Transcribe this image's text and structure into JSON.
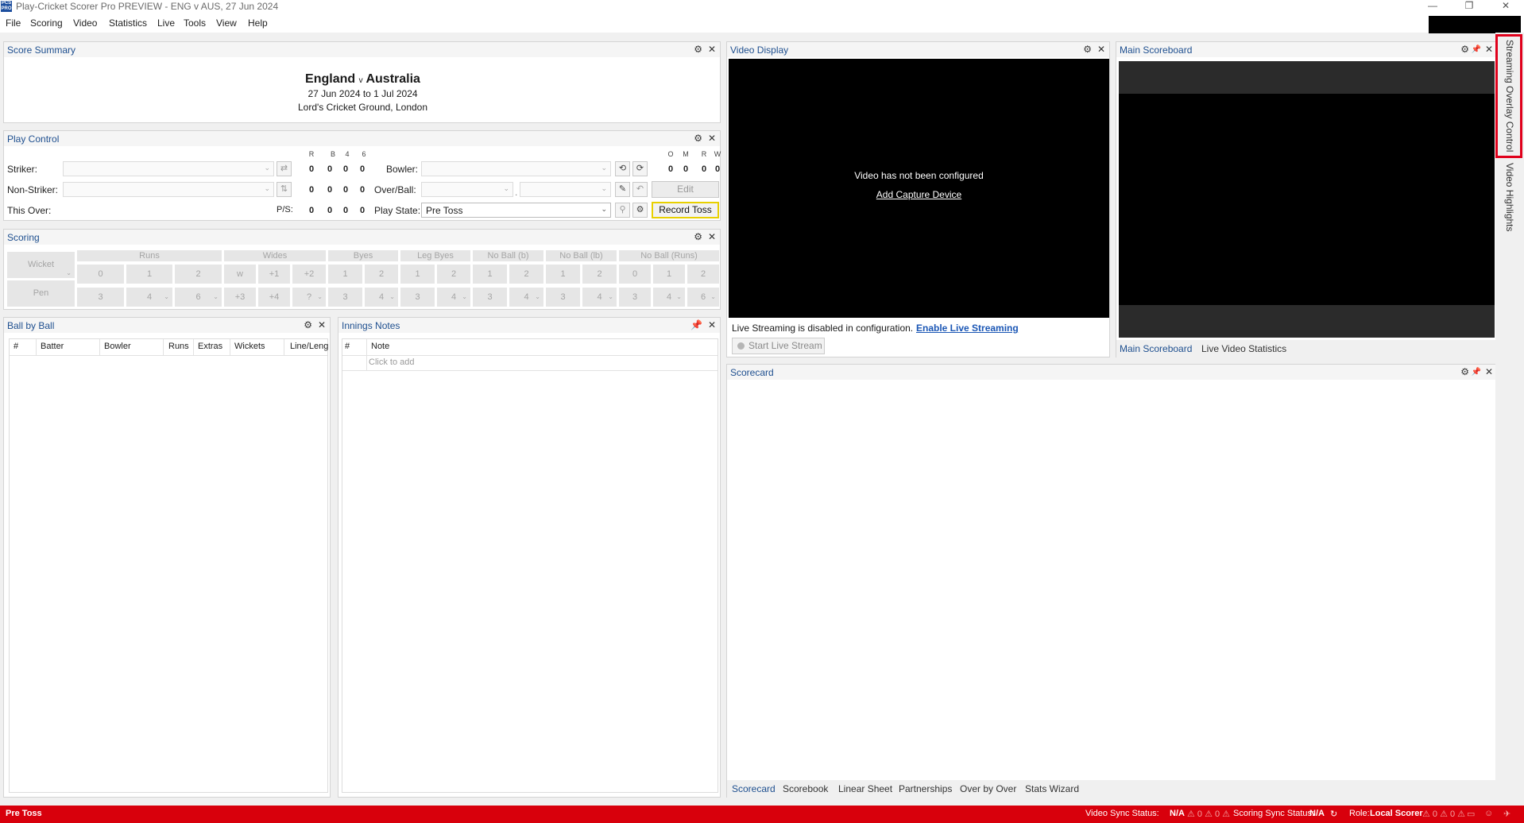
{
  "app": {
    "title": "Play-Cricket Scorer Pro PREVIEW - ENG v AUS, 27 Jun 2024",
    "logo": "PCS PRO"
  },
  "window_controls": {
    "minimize": "—",
    "restore": "❐",
    "close": "✕"
  },
  "menu": [
    "File",
    "Scoring",
    "Video",
    "Statistics",
    "Live",
    "Tools",
    "View",
    "Help"
  ],
  "score_summary": {
    "title": "Score Summary",
    "team1": "England",
    "vs": "v",
    "team2": "Australia",
    "dates": "27 Jun 2024 to 1 Jul 2024",
    "venue": "Lord's Cricket Ground, London"
  },
  "play_control": {
    "title": "Play Control",
    "bat_headers": [
      "R",
      "B",
      "4",
      "6"
    ],
    "bowl_headers": [
      "O",
      "M",
      "R",
      "W"
    ],
    "striker_label": "Striker:",
    "nonstriker_label": "Non-Striker:",
    "thisover_label": "This Over:",
    "ps_label": "P/S:",
    "striker_stats": [
      "0",
      "0",
      "0",
      "0"
    ],
    "nonstriker_stats": [
      "0",
      "0",
      "0",
      "0"
    ],
    "ps_stats": [
      "0",
      "0",
      "0",
      "0"
    ],
    "bowler_label": "Bowler:",
    "overball_label": "Over/Ball:",
    "playstate_label": "Play State:",
    "bowler_stats": [
      "0",
      "0",
      "0",
      "0"
    ],
    "play_state_value": "Pre Toss",
    "edit_button": "Edit",
    "record_toss_button": "Record Toss",
    "dot": "."
  },
  "scoring": {
    "title": "Scoring",
    "wicket": "Wicket",
    "pen": "Pen",
    "groups": [
      "Runs",
      "Wides",
      "Byes",
      "Leg Byes",
      "No Ball (b)",
      "No Ball (lb)",
      "No Ball (Runs)"
    ],
    "runs_row1": [
      "0",
      "1",
      "2"
    ],
    "runs_row2": [
      "3",
      "4",
      "6"
    ],
    "wides_row1": [
      "w",
      "+1",
      "+2"
    ],
    "wides_row2": [
      "+3",
      "+4",
      "?"
    ],
    "byes_row1": [
      "1",
      "2"
    ],
    "byes_row2": [
      "3",
      "4"
    ],
    "legbyes_row1": [
      "1",
      "2"
    ],
    "legbyes_row2": [
      "3",
      "4"
    ],
    "nbb_row1": [
      "1",
      "2"
    ],
    "nbb_row2": [
      "3",
      "4"
    ],
    "nblb_row1": [
      "1",
      "2"
    ],
    "nblb_row2": [
      "3",
      "4"
    ],
    "nbr_row1": [
      "0",
      "1",
      "2"
    ],
    "nbr_row2": [
      "3",
      "4",
      "6"
    ]
  },
  "ball_by_ball": {
    "title": "Ball by Ball",
    "columns": [
      "#",
      "Batter",
      "Bowler",
      "Runs",
      "Extras",
      "Wickets",
      "Line/Leng"
    ]
  },
  "innings_notes": {
    "title": "Innings Notes",
    "columns": [
      "#",
      "Note"
    ],
    "placeholder": "Click to add"
  },
  "video_display": {
    "title": "Video Display",
    "message": "Video has not been configured",
    "add_device": "Add Capture Device",
    "streaming_disabled": "Live Streaming is disabled in configuration.",
    "enable_streaming": "Enable Live Streaming",
    "start_stream": "Start Live Stream"
  },
  "main_scoreboard": {
    "title": "Main Scoreboard",
    "tabs": [
      "Main Scoreboard",
      "Live Video Statistics"
    ]
  },
  "scorecard": {
    "title": "Scorecard",
    "tabs": [
      "Scorecard",
      "Scorebook",
      "Linear Sheet",
      "Partnerships",
      "Over by Over",
      "Stats Wizard"
    ]
  },
  "side_tabs": [
    "Streaming Overlay Control",
    "Video Highlights"
  ],
  "status": {
    "state": "Pre Toss",
    "video_sync_label": "Video Sync Status:",
    "video_sync_value": "N/A",
    "scoring_sync_label": "Scoring Sync Status:",
    "scoring_sync_value": "N/A",
    "role_label": "Role:",
    "role_value": "Local Scorer",
    "counts": "⚠ 0 ⚠ 0 ⚠"
  },
  "colors": {
    "accent": "#1e4f8f",
    "status_bar": "#d8000c",
    "highlight_border": "#e8d000",
    "callout": "#e0001b"
  }
}
